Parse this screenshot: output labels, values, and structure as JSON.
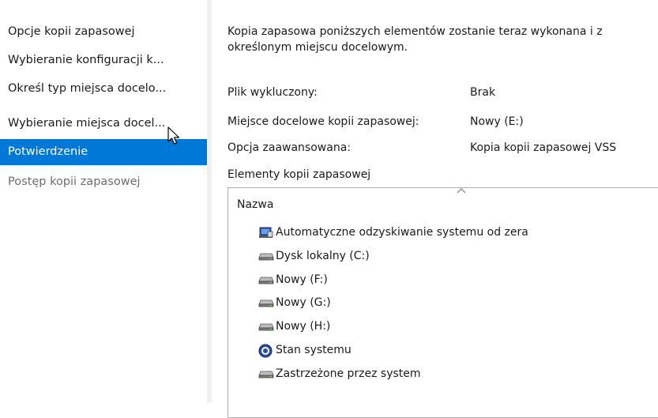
{
  "sidebar": {
    "items": [
      {
        "label": "Opcje kopii zapasowej",
        "state": "normal"
      },
      {
        "label": "Wybieranie konfiguracji k...",
        "state": "normal"
      },
      {
        "label": "Określ typ miejsca docelo...",
        "state": "normal"
      },
      {
        "label": "Wybieranie miejsca docel...",
        "state": "normal"
      },
      {
        "label": "Potwierdzenie",
        "state": "active"
      },
      {
        "label": "Postęp kopii zapasowej",
        "state": "disabled"
      }
    ]
  },
  "main": {
    "intro_line1": "Kopia zapasowa poniższych elementów zostanie teraz wykonana i z",
    "intro_line2": "określonym miejscu docelowym.",
    "summary": [
      {
        "label": "Plik wykluczony:",
        "value": "Brak"
      },
      {
        "label": "Miejsce docelowe kopii zapasowej:",
        "value": "Nowy (E:)"
      },
      {
        "label": "Opcja zaawansowana:",
        "value": "Kopia kopii zapasowej VSS"
      }
    ],
    "items_title": "Elementy kopii zapasowej",
    "column_header": "Nazwa",
    "items": [
      {
        "label": "Automatyczne odzyskiwanie systemu od zera",
        "icon": "bare-metal-recovery-icon"
      },
      {
        "label": "Dysk lokalny (C:)",
        "icon": "drive-icon"
      },
      {
        "label": "Nowy (F:)",
        "icon": "drive-icon"
      },
      {
        "label": "Nowy (G:)",
        "icon": "drive-icon"
      },
      {
        "label": "Nowy (H:)",
        "icon": "drive-icon"
      },
      {
        "label": "Stan systemu",
        "icon": "system-state-icon"
      },
      {
        "label": "Zastrzeżone przez system",
        "icon": "drive-icon"
      }
    ]
  },
  "colors": {
    "accent": "#0078d7",
    "separator": "#f0f0f0",
    "disabled_text": "#6d6d6d"
  }
}
